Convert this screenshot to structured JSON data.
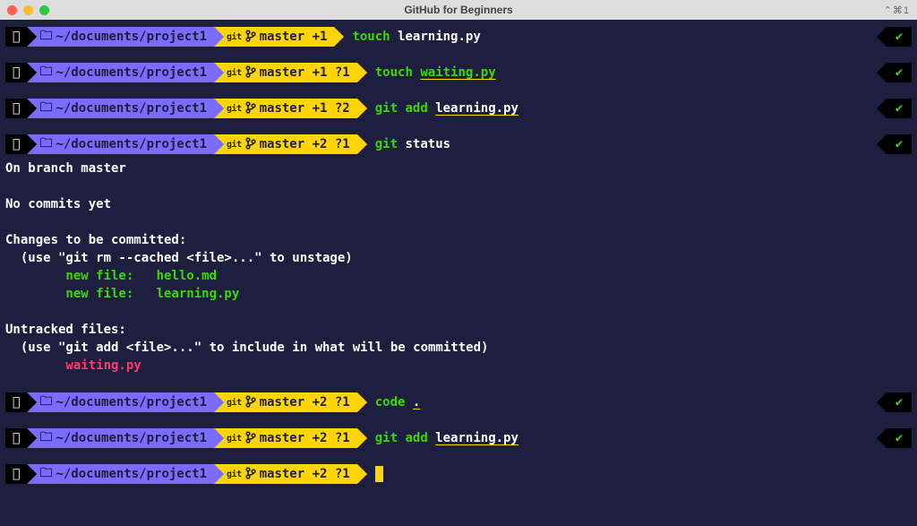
{
  "window": {
    "title": "GitHub for Beginners",
    "menu_glyphs": "⌃⌘1"
  },
  "path": {
    "tilde": "~",
    "sep": "/",
    "d1": "documents",
    "d2": "project1"
  },
  "git": {
    "label": "git",
    "branch": "master"
  },
  "lines": [
    {
      "stage": "+1",
      "untracked": "",
      "cmd_prefix": "touch",
      "cmd_arg": "learning.py",
      "arg_style": "white"
    },
    {
      "stage": "+1 ?1",
      "untracked": "",
      "cmd_prefix": "touch",
      "cmd_arg": "waiting.py",
      "arg_style": "green-ul"
    },
    {
      "stage": "+1 ?2",
      "untracked": "",
      "cmd_prefix": "git add",
      "cmd_arg": "learning.py",
      "arg_style": "white-ul"
    },
    {
      "stage": "+2 ?1",
      "untracked": "",
      "cmd_prefix": "git",
      "cmd_arg": "status",
      "arg_style": "white"
    }
  ],
  "status_output": {
    "on_branch": "On branch master",
    "no_commits": "No commits yet",
    "changes_hdr": "Changes to be committed:",
    "unstage_hint": "  (use \"git rm --cached <file>...\" to unstage)",
    "new1": "        new file:   hello.md",
    "new2": "        new file:   learning.py",
    "untracked_hdr": "Untracked files:",
    "include_hint": "  (use \"git add <file>...\" to include in what will be committed)",
    "untracked1": "        waiting.py"
  },
  "tail": [
    {
      "stage": "+2 ?1",
      "cmd_prefix": "code",
      "cmd_arg": ".",
      "arg_style": "white-ul"
    },
    {
      "stage": "+2 ?1",
      "cmd_prefix": "git add",
      "cmd_arg": "learning.py",
      "arg_style": "white-ul"
    },
    {
      "stage": "+2 ?1",
      "cmd_prefix": "",
      "cmd_arg": "",
      "arg_style": "cursor"
    }
  ],
  "tick": "✔"
}
